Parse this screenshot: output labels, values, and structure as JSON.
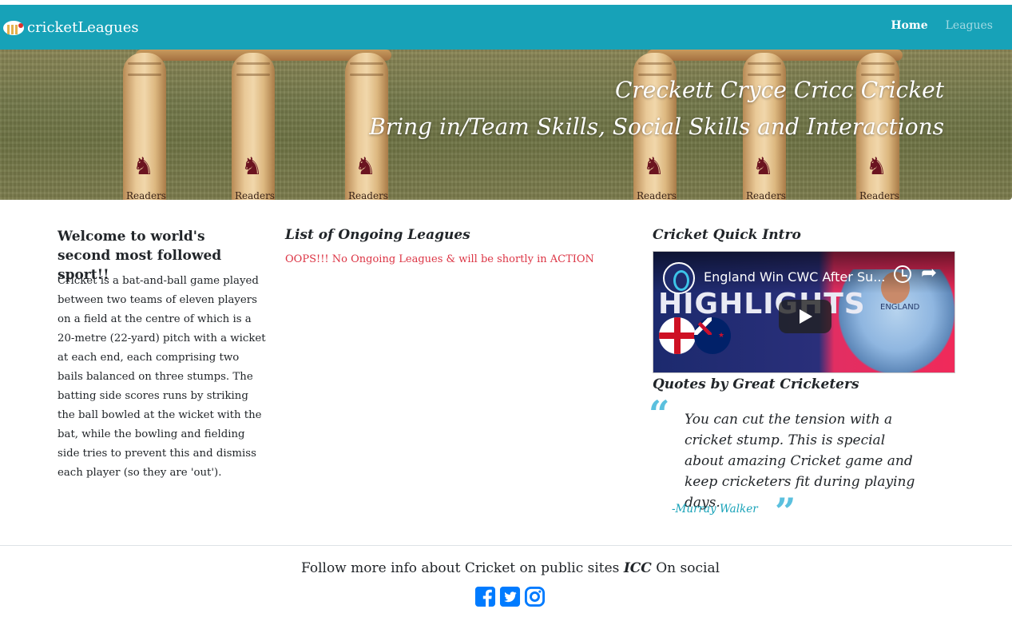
{
  "navbar": {
    "brand": "cricketLeagues",
    "links": [
      {
        "label": "Home",
        "active": true
      },
      {
        "label": "Leagues",
        "active": false
      }
    ],
    "background": "#17a2b8"
  },
  "hero": {
    "title": "Creckett Cryce Cricc Cricket",
    "subtitle": "Bring in/Team Skills, Social Skills and Interactions",
    "stump_brand": "Readers"
  },
  "welcome": {
    "title": "Welcome to world's second most followed sport!!",
    "body": "Cricket is a bat-and-ball game played between two teams of eleven players on a field at the centre of which is a 20-metre (22-yard) pitch with a wicket at each end, each comprising two bails balanced on three stumps. The batting side scores runs by striking the ball bowled at the wicket with the bat, while the bowling and fielding side tries to prevent this and dismiss each player (so they are 'out')."
  },
  "leagues": {
    "title": "List of Ongoing Leagues",
    "empty_message": "OOPS!!! No Ongoing Leagues & will be shortly in ACTION",
    "empty_color": "#dc3545"
  },
  "intro": {
    "title": "Cricket Quick Intro",
    "video": {
      "title": "England Win CWC After Su...",
      "overlay_text": "HIGHLIGHTS",
      "jersey_text": "ENGLAND"
    }
  },
  "quotes": {
    "title": "Quotes by Great Cricketers",
    "text": "You can cut the tension with a cricket stump. This is special about amazing Cricket game and keep cricketers fit during playing days.",
    "author": "-Murray Walker",
    "accent_color": "#5bc0de"
  },
  "footer": {
    "text_before": "Follow more info about Cricket on public sites ",
    "text_em": "ICC",
    "text_after": " On social",
    "social": [
      {
        "icon": "facebook-icon"
      },
      {
        "icon": "twitter-icon"
      },
      {
        "icon": "instagram-icon"
      }
    ],
    "icon_color": "#007bff"
  }
}
